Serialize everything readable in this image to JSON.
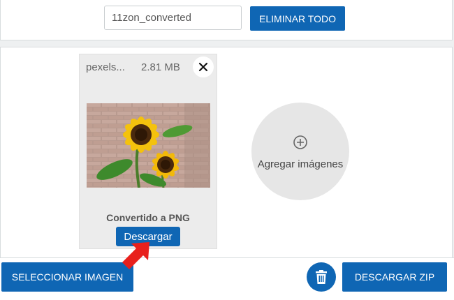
{
  "top": {
    "filename_value": "11zon_converted",
    "clear_all_label": "ELIMINAR TODO"
  },
  "file": {
    "name": "pexels...",
    "size": "2.81 MB",
    "status": "Convertido a PNG",
    "download_label": "Descargar",
    "thumbnail": "sunflower-image"
  },
  "add": {
    "label": "Agregar imágenes",
    "icon": "plus-circle-icon"
  },
  "bottom": {
    "select_label": "SELECCIONAR IMAGEN",
    "zip_label": "DESCARGAR ZIP",
    "delete_icon": "trash-icon"
  },
  "colors": {
    "accent": "#0f66b4",
    "arrow": "#e8201c",
    "card_bg": "#ececec"
  }
}
